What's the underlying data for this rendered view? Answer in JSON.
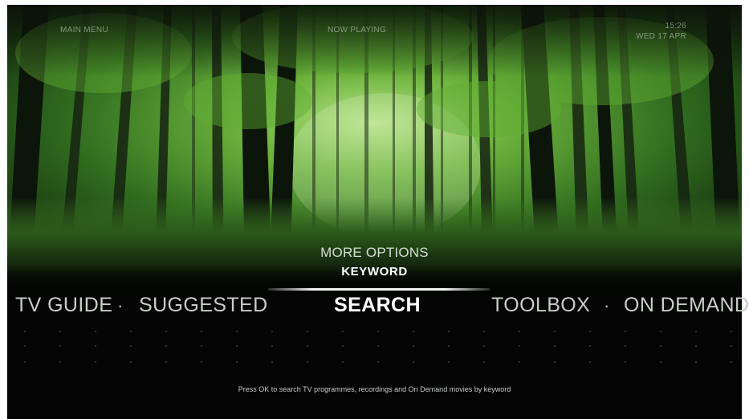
{
  "header": {
    "left_label": "MAIN MENU",
    "center_label": "NOW PLAYING",
    "time": "15:26",
    "date": "WED 17 APR"
  },
  "more_options": {
    "label": "MORE OPTIONS",
    "keyword": "KEYWORD"
  },
  "menu": {
    "items": [
      {
        "label": "TV GUIDE",
        "active": false
      },
      {
        "label": "SUGGESTED",
        "active": false
      },
      {
        "label": "SEARCH",
        "active": true
      },
      {
        "label": "TOOLBOX",
        "active": false
      },
      {
        "label": "ON DEMAND",
        "active": false
      }
    ],
    "separator": "·"
  },
  "hint": "Press OK to search TV programmes, recordings and On Demand movies by keyword",
  "colors": {
    "forest_light": "#7ec24a",
    "forest_dark": "#0e1a0b",
    "text": "#ffffff"
  }
}
